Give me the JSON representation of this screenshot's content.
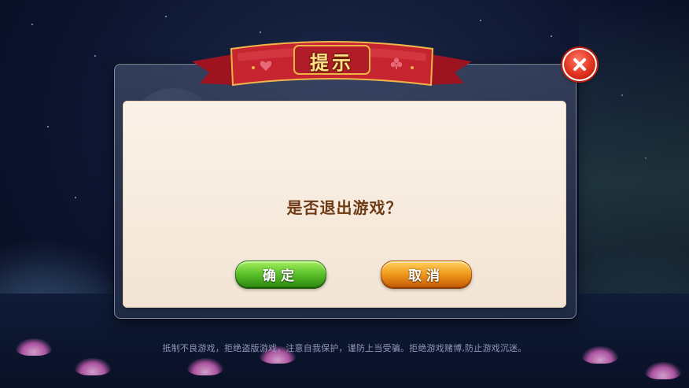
{
  "dialog": {
    "title": "提示",
    "message": "是否退出游戏？",
    "confirm_label": "确定",
    "cancel_label": "取消"
  },
  "footer": {
    "notice": "抵制不良游戏，拒绝盗版游戏，注意自我保护，谨防上当受骗。拒绝游戏赌博,防止游戏沉迷。"
  },
  "icons": {
    "close": "close-icon",
    "ribbon_suit_left": "heart-suit-icon",
    "ribbon_suit_right": "club-suit-icon"
  },
  "colors": {
    "ribbon_red": "#c6242f",
    "title_gold": "#ffe08a",
    "message_brown": "#6e3a14",
    "confirm_green": "#5bc12a",
    "cancel_orange": "#f19a1d",
    "close_red": "#e2321e"
  }
}
